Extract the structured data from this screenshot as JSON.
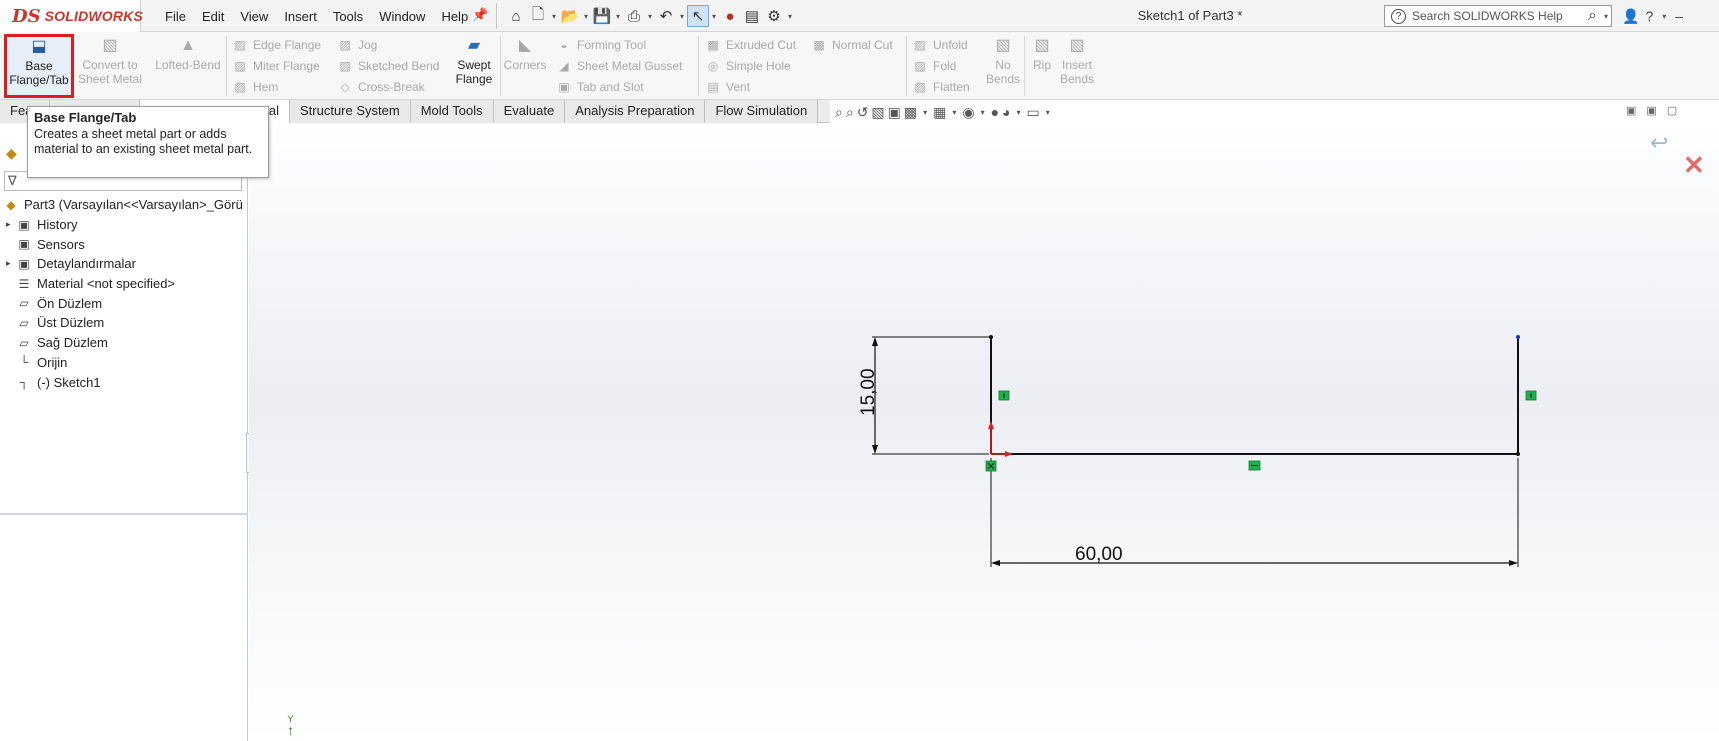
{
  "app": {
    "logo_mark": "DS",
    "logo_name": "SOLIDWORKS",
    "doc_title": "Sketch1 of Part3 *"
  },
  "menu": [
    "File",
    "Edit",
    "View",
    "Insert",
    "Tools",
    "Window",
    "Help"
  ],
  "search": {
    "placeholder": "Search SOLIDWORKS Help"
  },
  "ribbon": {
    "base_flange": "Base Flange/Tab",
    "convert": "Convert to Sheet Metal",
    "lofted": "Lofted-Bend",
    "edge_flange": "Edge Flange",
    "miter_flange": "Miter Flange",
    "hem": "Hem",
    "jog": "Jog",
    "sketched_bend": "Sketched Bend",
    "cross_break": "Cross-Break",
    "swept_flange": "Swept Flange",
    "corners": "Corners",
    "forming_tool": "Forming Tool",
    "sheet_metal_gusset": "Sheet Metal Gusset",
    "tab_and_slot": "Tab and Slot",
    "extruded_cut": "Extruded Cut",
    "simple_hole": "Simple Hole",
    "vent": "Vent",
    "normal_cut": "Normal Cut",
    "unfold": "Unfold",
    "fold": "Fold",
    "flatten": "Flatten",
    "no_bends": "No Bends",
    "rip": "Rip",
    "insert_bends": "Insert Bends"
  },
  "tabs": [
    "Fea",
    "al",
    "Structure System",
    "Mold Tools",
    "Evaluate",
    "Analysis Preparation",
    "Flow Simulation"
  ],
  "tooltip": {
    "title": "Base Flange/Tab",
    "desc": "Creates a sheet metal part or adds material to an existing sheet metal part."
  },
  "tree": {
    "root": "Part3  (Varsayılan<<Varsayılan>_Görü",
    "items": [
      "History",
      "Sensors",
      "Detaylandırmalar",
      "Material <not specified>",
      "Ön Düzlem",
      "Üst Düzlem",
      "Sağ Düzlem",
      "Orijin",
      "(-) Sketch1"
    ]
  },
  "sketch": {
    "dim_height": "15,00",
    "dim_width": "60,00"
  },
  "axis_label": "Y",
  "colors": {
    "logo": "#d0332c",
    "highlight": "#e11b22",
    "relation": "#1db34c",
    "origin": "#e02020"
  }
}
